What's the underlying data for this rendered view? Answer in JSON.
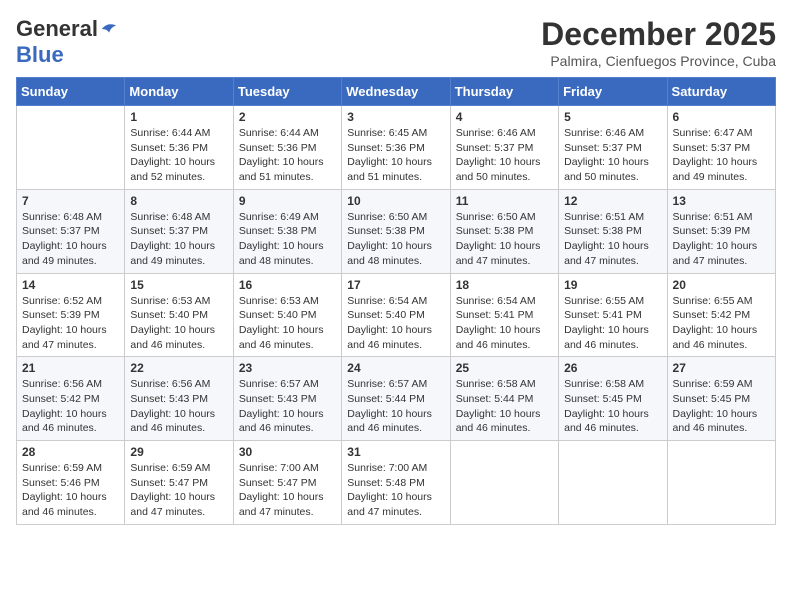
{
  "header": {
    "logo_general": "General",
    "logo_blue": "Blue",
    "month_title": "December 2025",
    "location": "Palmira, Cienfuegos Province, Cuba"
  },
  "calendar": {
    "columns": [
      "Sunday",
      "Monday",
      "Tuesday",
      "Wednesday",
      "Thursday",
      "Friday",
      "Saturday"
    ],
    "weeks": [
      [
        {
          "day": "",
          "info": ""
        },
        {
          "day": "1",
          "info": "Sunrise: 6:44 AM\nSunset: 5:36 PM\nDaylight: 10 hours\nand 52 minutes."
        },
        {
          "day": "2",
          "info": "Sunrise: 6:44 AM\nSunset: 5:36 PM\nDaylight: 10 hours\nand 51 minutes."
        },
        {
          "day": "3",
          "info": "Sunrise: 6:45 AM\nSunset: 5:36 PM\nDaylight: 10 hours\nand 51 minutes."
        },
        {
          "day": "4",
          "info": "Sunrise: 6:46 AM\nSunset: 5:37 PM\nDaylight: 10 hours\nand 50 minutes."
        },
        {
          "day": "5",
          "info": "Sunrise: 6:46 AM\nSunset: 5:37 PM\nDaylight: 10 hours\nand 50 minutes."
        },
        {
          "day": "6",
          "info": "Sunrise: 6:47 AM\nSunset: 5:37 PM\nDaylight: 10 hours\nand 49 minutes."
        }
      ],
      [
        {
          "day": "7",
          "info": "Sunrise: 6:48 AM\nSunset: 5:37 PM\nDaylight: 10 hours\nand 49 minutes."
        },
        {
          "day": "8",
          "info": "Sunrise: 6:48 AM\nSunset: 5:37 PM\nDaylight: 10 hours\nand 49 minutes."
        },
        {
          "day": "9",
          "info": "Sunrise: 6:49 AM\nSunset: 5:38 PM\nDaylight: 10 hours\nand 48 minutes."
        },
        {
          "day": "10",
          "info": "Sunrise: 6:50 AM\nSunset: 5:38 PM\nDaylight: 10 hours\nand 48 minutes."
        },
        {
          "day": "11",
          "info": "Sunrise: 6:50 AM\nSunset: 5:38 PM\nDaylight: 10 hours\nand 47 minutes."
        },
        {
          "day": "12",
          "info": "Sunrise: 6:51 AM\nSunset: 5:38 PM\nDaylight: 10 hours\nand 47 minutes."
        },
        {
          "day": "13",
          "info": "Sunrise: 6:51 AM\nSunset: 5:39 PM\nDaylight: 10 hours\nand 47 minutes."
        }
      ],
      [
        {
          "day": "14",
          "info": "Sunrise: 6:52 AM\nSunset: 5:39 PM\nDaylight: 10 hours\nand 47 minutes."
        },
        {
          "day": "15",
          "info": "Sunrise: 6:53 AM\nSunset: 5:40 PM\nDaylight: 10 hours\nand 46 minutes."
        },
        {
          "day": "16",
          "info": "Sunrise: 6:53 AM\nSunset: 5:40 PM\nDaylight: 10 hours\nand 46 minutes."
        },
        {
          "day": "17",
          "info": "Sunrise: 6:54 AM\nSunset: 5:40 PM\nDaylight: 10 hours\nand 46 minutes."
        },
        {
          "day": "18",
          "info": "Sunrise: 6:54 AM\nSunset: 5:41 PM\nDaylight: 10 hours\nand 46 minutes."
        },
        {
          "day": "19",
          "info": "Sunrise: 6:55 AM\nSunset: 5:41 PM\nDaylight: 10 hours\nand 46 minutes."
        },
        {
          "day": "20",
          "info": "Sunrise: 6:55 AM\nSunset: 5:42 PM\nDaylight: 10 hours\nand 46 minutes."
        }
      ],
      [
        {
          "day": "21",
          "info": "Sunrise: 6:56 AM\nSunset: 5:42 PM\nDaylight: 10 hours\nand 46 minutes."
        },
        {
          "day": "22",
          "info": "Sunrise: 6:56 AM\nSunset: 5:43 PM\nDaylight: 10 hours\nand 46 minutes."
        },
        {
          "day": "23",
          "info": "Sunrise: 6:57 AM\nSunset: 5:43 PM\nDaylight: 10 hours\nand 46 minutes."
        },
        {
          "day": "24",
          "info": "Sunrise: 6:57 AM\nSunset: 5:44 PM\nDaylight: 10 hours\nand 46 minutes."
        },
        {
          "day": "25",
          "info": "Sunrise: 6:58 AM\nSunset: 5:44 PM\nDaylight: 10 hours\nand 46 minutes."
        },
        {
          "day": "26",
          "info": "Sunrise: 6:58 AM\nSunset: 5:45 PM\nDaylight: 10 hours\nand 46 minutes."
        },
        {
          "day": "27",
          "info": "Sunrise: 6:59 AM\nSunset: 5:45 PM\nDaylight: 10 hours\nand 46 minutes."
        }
      ],
      [
        {
          "day": "28",
          "info": "Sunrise: 6:59 AM\nSunset: 5:46 PM\nDaylight: 10 hours\nand 46 minutes."
        },
        {
          "day": "29",
          "info": "Sunrise: 6:59 AM\nSunset: 5:47 PM\nDaylight: 10 hours\nand 47 minutes."
        },
        {
          "day": "30",
          "info": "Sunrise: 7:00 AM\nSunset: 5:47 PM\nDaylight: 10 hours\nand 47 minutes."
        },
        {
          "day": "31",
          "info": "Sunrise: 7:00 AM\nSunset: 5:48 PM\nDaylight: 10 hours\nand 47 minutes."
        },
        {
          "day": "",
          "info": ""
        },
        {
          "day": "",
          "info": ""
        },
        {
          "day": "",
          "info": ""
        }
      ]
    ]
  }
}
